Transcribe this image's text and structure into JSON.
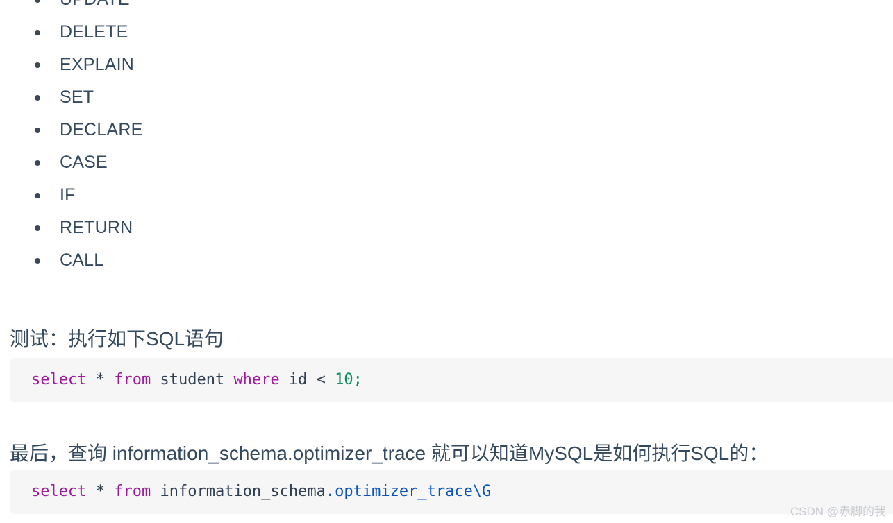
{
  "keyword_list": {
    "items": [
      {
        "label": "UPDATE"
      },
      {
        "label": "DELETE"
      },
      {
        "label": "EXPLAIN"
      },
      {
        "label": "SET"
      },
      {
        "label": "DECLARE"
      },
      {
        "label": "CASE"
      },
      {
        "label": "IF"
      },
      {
        "label": "RETURN"
      },
      {
        "label": "CALL"
      }
    ]
  },
  "paragraphs": {
    "test_intro": "测试：执行如下SQL语句",
    "final_note": "最后，查询 information_schema.optimizer_trace 就可以知道MySQL是如何执行SQL的："
  },
  "code_blocks": [
    {
      "language": "sql",
      "plain": "select * from student where id < 10;",
      "tokens": [
        {
          "text": "select",
          "type": "keyword"
        },
        {
          "text": " ",
          "type": "plain"
        },
        {
          "text": "*",
          "type": "operator"
        },
        {
          "text": " ",
          "type": "plain"
        },
        {
          "text": "from",
          "type": "keyword"
        },
        {
          "text": " ",
          "type": "plain"
        },
        {
          "text": "student",
          "type": "identifier"
        },
        {
          "text": " ",
          "type": "plain"
        },
        {
          "text": "where",
          "type": "keyword"
        },
        {
          "text": " ",
          "type": "plain"
        },
        {
          "text": "id",
          "type": "identifier"
        },
        {
          "text": " ",
          "type": "plain"
        },
        {
          "text": "<",
          "type": "operator"
        },
        {
          "text": " ",
          "type": "plain"
        },
        {
          "text": "10",
          "type": "number"
        },
        {
          "text": ";",
          "type": "punctuation"
        }
      ]
    },
    {
      "language": "sql",
      "plain": "select * from information_schema.optimizer_trace\\G",
      "tokens": [
        {
          "text": "select",
          "type": "keyword"
        },
        {
          "text": " ",
          "type": "plain"
        },
        {
          "text": "*",
          "type": "operator"
        },
        {
          "text": " ",
          "type": "plain"
        },
        {
          "text": "from",
          "type": "keyword"
        },
        {
          "text": " ",
          "type": "plain"
        },
        {
          "text": "information_schema",
          "type": "identifier"
        },
        {
          "text": ".optimizer_trace\\G",
          "type": "property"
        }
      ]
    }
  ],
  "watermark": {
    "text": "CSDN @赤脚的我"
  },
  "colors": {
    "body_text": "#34495e",
    "code_background": "#f6f6f6",
    "keyword": "#a01a9e",
    "number": "#0f8a63",
    "property": "#0b52bd",
    "identifier": "#2f3e52",
    "watermark": "#c8ccd2"
  }
}
